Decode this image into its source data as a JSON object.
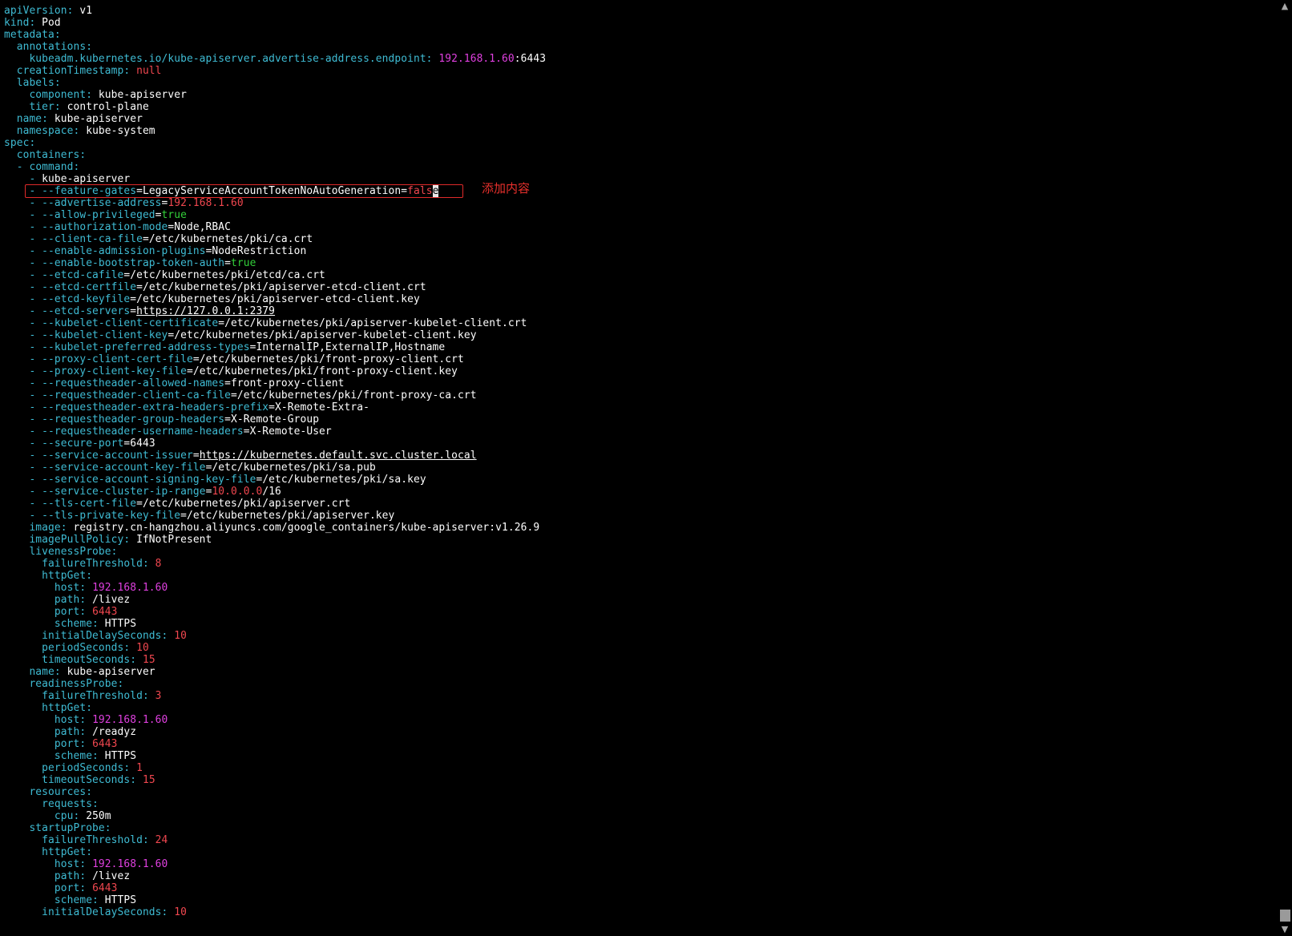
{
  "annotation_label": "添加内容",
  "colors": {
    "key": "#3fbcd4",
    "number": "#f0474f",
    "ip": "#e040e0",
    "boolean": "#33d13a",
    "text": "#ffffff",
    "highlight_border": "#e02a2a",
    "background": "#000000"
  },
  "icons": {
    "scroll_up": "chevron-up-icon",
    "scroll_down": "chevron-down-icon"
  },
  "lines": [
    [
      [
        "k",
        "apiVersion:"
      ],
      [
        "",
        "v1"
      ]
    ],
    [
      [
        "k",
        "kind:"
      ],
      [
        "",
        "Pod"
      ]
    ],
    [
      [
        "k",
        "metadata:"
      ]
    ],
    [
      [
        "k",
        "  annotations:"
      ]
    ],
    [
      [
        "k",
        "    kubeadm.kubernetes.io/kube-apiserver.advertise-address.endpoint:"
      ],
      [
        "",
        ""
      ],
      [
        "p",
        "192.168.1.60"
      ],
      [
        "",
        ":6443"
      ]
    ],
    [
      [
        "k",
        "  creationTimestamp:"
      ],
      [
        "",
        ""
      ],
      [
        "n",
        "null"
      ]
    ],
    [
      [
        "k",
        "  labels:"
      ]
    ],
    [
      [
        "k",
        "    component:"
      ],
      [
        "",
        "kube-apiserver"
      ]
    ],
    [
      [
        "k",
        "    tier:"
      ],
      [
        "",
        "control-plane"
      ]
    ],
    [
      [
        "k",
        "  name:"
      ],
      [
        "",
        "kube-apiserver"
      ]
    ],
    [
      [
        "k",
        "  namespace:"
      ],
      [
        "",
        "kube-system"
      ]
    ],
    [
      [
        "k",
        "spec:"
      ]
    ],
    [
      [
        "k",
        "  containers:"
      ]
    ],
    [
      [
        "d",
        "  - "
      ],
      [
        "k",
        "command:"
      ]
    ],
    [
      [
        "d",
        "    - "
      ],
      [
        "",
        "kube-apiserver"
      ]
    ],
    [
      [
        "d",
        "    - "
      ],
      [
        "f",
        "--feature-gates"
      ],
      [
        "",
        "=LegacyServiceAccountTokenNoAutoGeneration="
      ],
      [
        "n",
        "fals"
      ],
      [
        "cursor",
        "e"
      ]
    ],
    [
      [
        "d",
        "    - "
      ],
      [
        "f",
        "--advertise-address"
      ],
      [
        "",
        "="
      ],
      [
        "n",
        "192.168.1.60"
      ]
    ],
    [
      [
        "d",
        "    - "
      ],
      [
        "f",
        "--allow-privileged"
      ],
      [
        "",
        "="
      ],
      [
        "b",
        "true"
      ]
    ],
    [
      [
        "d",
        "    - "
      ],
      [
        "f",
        "--authorization-mode"
      ],
      [
        "",
        "=Node,RBAC"
      ]
    ],
    [
      [
        "d",
        "    - "
      ],
      [
        "f",
        "--client-ca-file"
      ],
      [
        "",
        "=/etc/kubernetes/pki/ca.crt"
      ]
    ],
    [
      [
        "d",
        "    - "
      ],
      [
        "f",
        "--enable-admission-plugins"
      ],
      [
        "",
        "=NodeRestriction"
      ]
    ],
    [
      [
        "d",
        "    - "
      ],
      [
        "f",
        "--enable-bootstrap-token-auth"
      ],
      [
        "",
        "="
      ],
      [
        "b",
        "true"
      ]
    ],
    [
      [
        "d",
        "    - "
      ],
      [
        "f",
        "--etcd-cafile"
      ],
      [
        "",
        "=/etc/kubernetes/pki/etcd/ca.crt"
      ]
    ],
    [
      [
        "d",
        "    - "
      ],
      [
        "f",
        "--etcd-certfile"
      ],
      [
        "",
        "=/etc/kubernetes/pki/apiserver-etcd-client.crt"
      ]
    ],
    [
      [
        "d",
        "    - "
      ],
      [
        "f",
        "--etcd-keyfile"
      ],
      [
        "",
        "=/etc/kubernetes/pki/apiserver-etcd-client.key"
      ]
    ],
    [
      [
        "d",
        "    - "
      ],
      [
        "f",
        "--etcd-servers"
      ],
      [
        "",
        "="
      ],
      [
        "u",
        "https://127.0.0.1:2379"
      ]
    ],
    [
      [
        "d",
        "    - "
      ],
      [
        "f",
        "--kubelet-client-certificate"
      ],
      [
        "",
        "=/etc/kubernetes/pki/apiserver-kubelet-client.crt"
      ]
    ],
    [
      [
        "d",
        "    - "
      ],
      [
        "f",
        "--kubelet-client-key"
      ],
      [
        "",
        "=/etc/kubernetes/pki/apiserver-kubelet-client.key"
      ]
    ],
    [
      [
        "d",
        "    - "
      ],
      [
        "f",
        "--kubelet-preferred-address-types"
      ],
      [
        "",
        "=InternalIP,ExternalIP,Hostname"
      ]
    ],
    [
      [
        "d",
        "    - "
      ],
      [
        "f",
        "--proxy-client-cert-file"
      ],
      [
        "",
        "=/etc/kubernetes/pki/front-proxy-client.crt"
      ]
    ],
    [
      [
        "d",
        "    - "
      ],
      [
        "f",
        "--proxy-client-key-file"
      ],
      [
        "",
        "=/etc/kubernetes/pki/front-proxy-client.key"
      ]
    ],
    [
      [
        "d",
        "    - "
      ],
      [
        "f",
        "--requestheader-allowed-names"
      ],
      [
        "",
        "=front-proxy-client"
      ]
    ],
    [
      [
        "d",
        "    - "
      ],
      [
        "f",
        "--requestheader-client-ca-file"
      ],
      [
        "",
        "=/etc/kubernetes/pki/front-proxy-ca.crt"
      ]
    ],
    [
      [
        "d",
        "    - "
      ],
      [
        "f",
        "--requestheader-extra-headers-prefix"
      ],
      [
        "",
        "=X-Remote-Extra-"
      ]
    ],
    [
      [
        "d",
        "    - "
      ],
      [
        "f",
        "--requestheader-group-headers"
      ],
      [
        "",
        "=X-Remote-Group"
      ]
    ],
    [
      [
        "d",
        "    - "
      ],
      [
        "f",
        "--requestheader-username-headers"
      ],
      [
        "",
        "=X-Remote-User"
      ]
    ],
    [
      [
        "d",
        "    - "
      ],
      [
        "f",
        "--secure-port"
      ],
      [
        "",
        "=6443"
      ]
    ],
    [
      [
        "d",
        "    - "
      ],
      [
        "f",
        "--service-account-issuer"
      ],
      [
        "",
        "="
      ],
      [
        "u",
        "https://kubernetes.default.svc.cluster.local"
      ]
    ],
    [
      [
        "d",
        "    - "
      ],
      [
        "f",
        "--service-account-key-file"
      ],
      [
        "",
        "=/etc/kubernetes/pki/sa.pub"
      ]
    ],
    [
      [
        "d",
        "    - "
      ],
      [
        "f",
        "--service-account-signing-key-file"
      ],
      [
        "",
        "=/etc/kubernetes/pki/sa.key"
      ]
    ],
    [
      [
        "d",
        "    - "
      ],
      [
        "f",
        "--service-cluster-ip-range"
      ],
      [
        "",
        "="
      ],
      [
        "n",
        "10.0.0.0"
      ],
      [
        "",
        "/16"
      ]
    ],
    [
      [
        "d",
        "    - "
      ],
      [
        "f",
        "--tls-cert-file"
      ],
      [
        "",
        "=/etc/kubernetes/pki/apiserver.crt"
      ]
    ],
    [
      [
        "d",
        "    - "
      ],
      [
        "f",
        "--tls-private-key-file"
      ],
      [
        "",
        "=/etc/kubernetes/pki/apiserver.key"
      ]
    ],
    [
      [
        "k",
        "    image:"
      ],
      [
        "",
        "registry.cn-hangzhou.aliyuncs.com/google_containers/kube-apiserver:v1.26.9"
      ]
    ],
    [
      [
        "k",
        "    imagePullPolicy:"
      ],
      [
        "",
        "IfNotPresent"
      ]
    ],
    [
      [
        "k",
        "    livenessProbe:"
      ]
    ],
    [
      [
        "k",
        "      failureThreshold:"
      ],
      [
        "",
        ""
      ],
      [
        "n",
        "8"
      ]
    ],
    [
      [
        "k",
        "      httpGet:"
      ]
    ],
    [
      [
        "k",
        "        host:"
      ],
      [
        "",
        ""
      ],
      [
        "p",
        "192.168.1.60"
      ]
    ],
    [
      [
        "k",
        "        path:"
      ],
      [
        "",
        "/livez"
      ]
    ],
    [
      [
        "k",
        "        port:"
      ],
      [
        "",
        ""
      ],
      [
        "n",
        "6443"
      ]
    ],
    [
      [
        "k",
        "        scheme:"
      ],
      [
        "",
        "HTTPS"
      ]
    ],
    [
      [
        "k",
        "      initialDelaySeconds:"
      ],
      [
        "",
        ""
      ],
      [
        "n",
        "10"
      ]
    ],
    [
      [
        "k",
        "      periodSeconds:"
      ],
      [
        "",
        ""
      ],
      [
        "n",
        "10"
      ]
    ],
    [
      [
        "k",
        "      timeoutSeconds:"
      ],
      [
        "",
        ""
      ],
      [
        "n",
        "15"
      ]
    ],
    [
      [
        "k",
        "    name:"
      ],
      [
        "",
        "kube-apiserver"
      ]
    ],
    [
      [
        "k",
        "    readinessProbe:"
      ]
    ],
    [
      [
        "k",
        "      failureThreshold:"
      ],
      [
        "",
        ""
      ],
      [
        "n",
        "3"
      ]
    ],
    [
      [
        "k",
        "      httpGet:"
      ]
    ],
    [
      [
        "k",
        "        host:"
      ],
      [
        "",
        ""
      ],
      [
        "p",
        "192.168.1.60"
      ]
    ],
    [
      [
        "k",
        "        path:"
      ],
      [
        "",
        "/readyz"
      ]
    ],
    [
      [
        "k",
        "        port:"
      ],
      [
        "",
        ""
      ],
      [
        "n",
        "6443"
      ]
    ],
    [
      [
        "k",
        "        scheme:"
      ],
      [
        "",
        "HTTPS"
      ]
    ],
    [
      [
        "k",
        "      periodSeconds:"
      ],
      [
        "",
        ""
      ],
      [
        "n",
        "1"
      ]
    ],
    [
      [
        "k",
        "      timeoutSeconds:"
      ],
      [
        "",
        ""
      ],
      [
        "n",
        "15"
      ]
    ],
    [
      [
        "k",
        "    resources:"
      ]
    ],
    [
      [
        "k",
        "      requests:"
      ]
    ],
    [
      [
        "k",
        "        cpu:"
      ],
      [
        "",
        "250m"
      ]
    ],
    [
      [
        "k",
        "    startupProbe:"
      ]
    ],
    [
      [
        "k",
        "      failureThreshold:"
      ],
      [
        "",
        ""
      ],
      [
        "n",
        "24"
      ]
    ],
    [
      [
        "k",
        "      httpGet:"
      ]
    ],
    [
      [
        "k",
        "        host:"
      ],
      [
        "",
        ""
      ],
      [
        "p",
        "192.168.1.60"
      ]
    ],
    [
      [
        "k",
        "        path:"
      ],
      [
        "",
        "/livez"
      ]
    ],
    [
      [
        "k",
        "        port:"
      ],
      [
        "",
        ""
      ],
      [
        "n",
        "6443"
      ]
    ],
    [
      [
        "k",
        "        scheme:"
      ],
      [
        "",
        "HTTPS"
      ]
    ],
    [
      [
        "k",
        "      initialDelaySeconds:"
      ],
      [
        "",
        ""
      ],
      [
        "n",
        "10"
      ]
    ]
  ]
}
